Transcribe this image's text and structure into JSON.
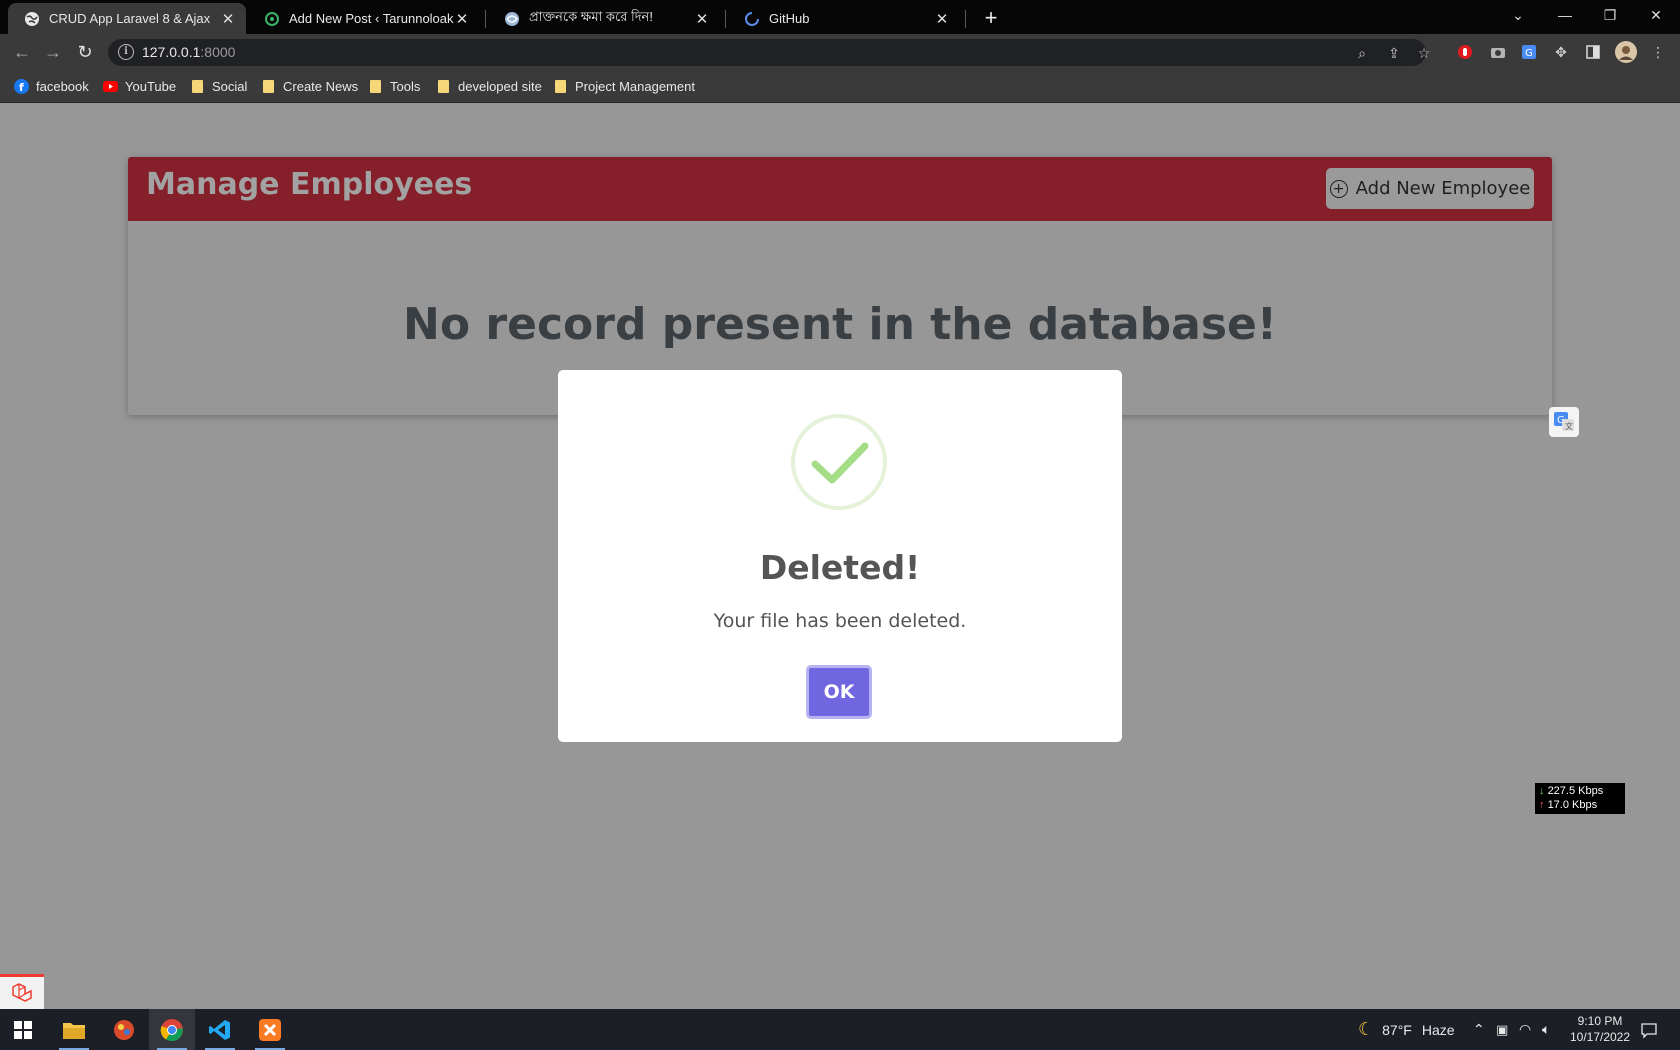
{
  "browser": {
    "tabs": [
      {
        "title": "CRUD App Laravel 8 & Ajax",
        "favicon": "globe-icon",
        "active": true
      },
      {
        "title": "Add New Post ‹ Tarunnoloak — W",
        "favicon": "wordpress-icon",
        "active": false
      },
      {
        "title": "প্রাক্তনকে ক্ষমা করে দিন!",
        "favicon": "swirl-icon",
        "active": false
      },
      {
        "title": "GitHub",
        "favicon": "loading-icon",
        "active": false
      }
    ],
    "url": {
      "host": "127.0.0.1",
      "port": ":8000"
    },
    "bookmarks": [
      {
        "label": "facebook",
        "icon": "facebook-icon"
      },
      {
        "label": "YouTube",
        "icon": "youtube-icon"
      },
      {
        "label": "Social",
        "icon": "folder-icon"
      },
      {
        "label": "Create News",
        "icon": "folder-icon"
      },
      {
        "label": "Tools",
        "icon": "folder-icon"
      },
      {
        "label": "developed site",
        "icon": "folder-icon"
      },
      {
        "label": "Project Management",
        "icon": "folder-icon"
      }
    ]
  },
  "page": {
    "title": "Manage Employees",
    "add_button_label": "Add New Employee",
    "empty_message": "No record present in the database!"
  },
  "dialog": {
    "title": "Deleted!",
    "text": "Your file has been deleted.",
    "ok_label": "OK"
  },
  "network_speed": {
    "download": "227.5 Kbps",
    "upload": "17.0 Kbps"
  },
  "taskbar": {
    "weather": "87°F",
    "weather_condition": "Haze",
    "time": "9:10 PM",
    "date": "10/17/2022"
  },
  "colors": {
    "header_bg": "#851f2a",
    "ok_button": "#7066e0",
    "success_check": "#a5dc86"
  }
}
